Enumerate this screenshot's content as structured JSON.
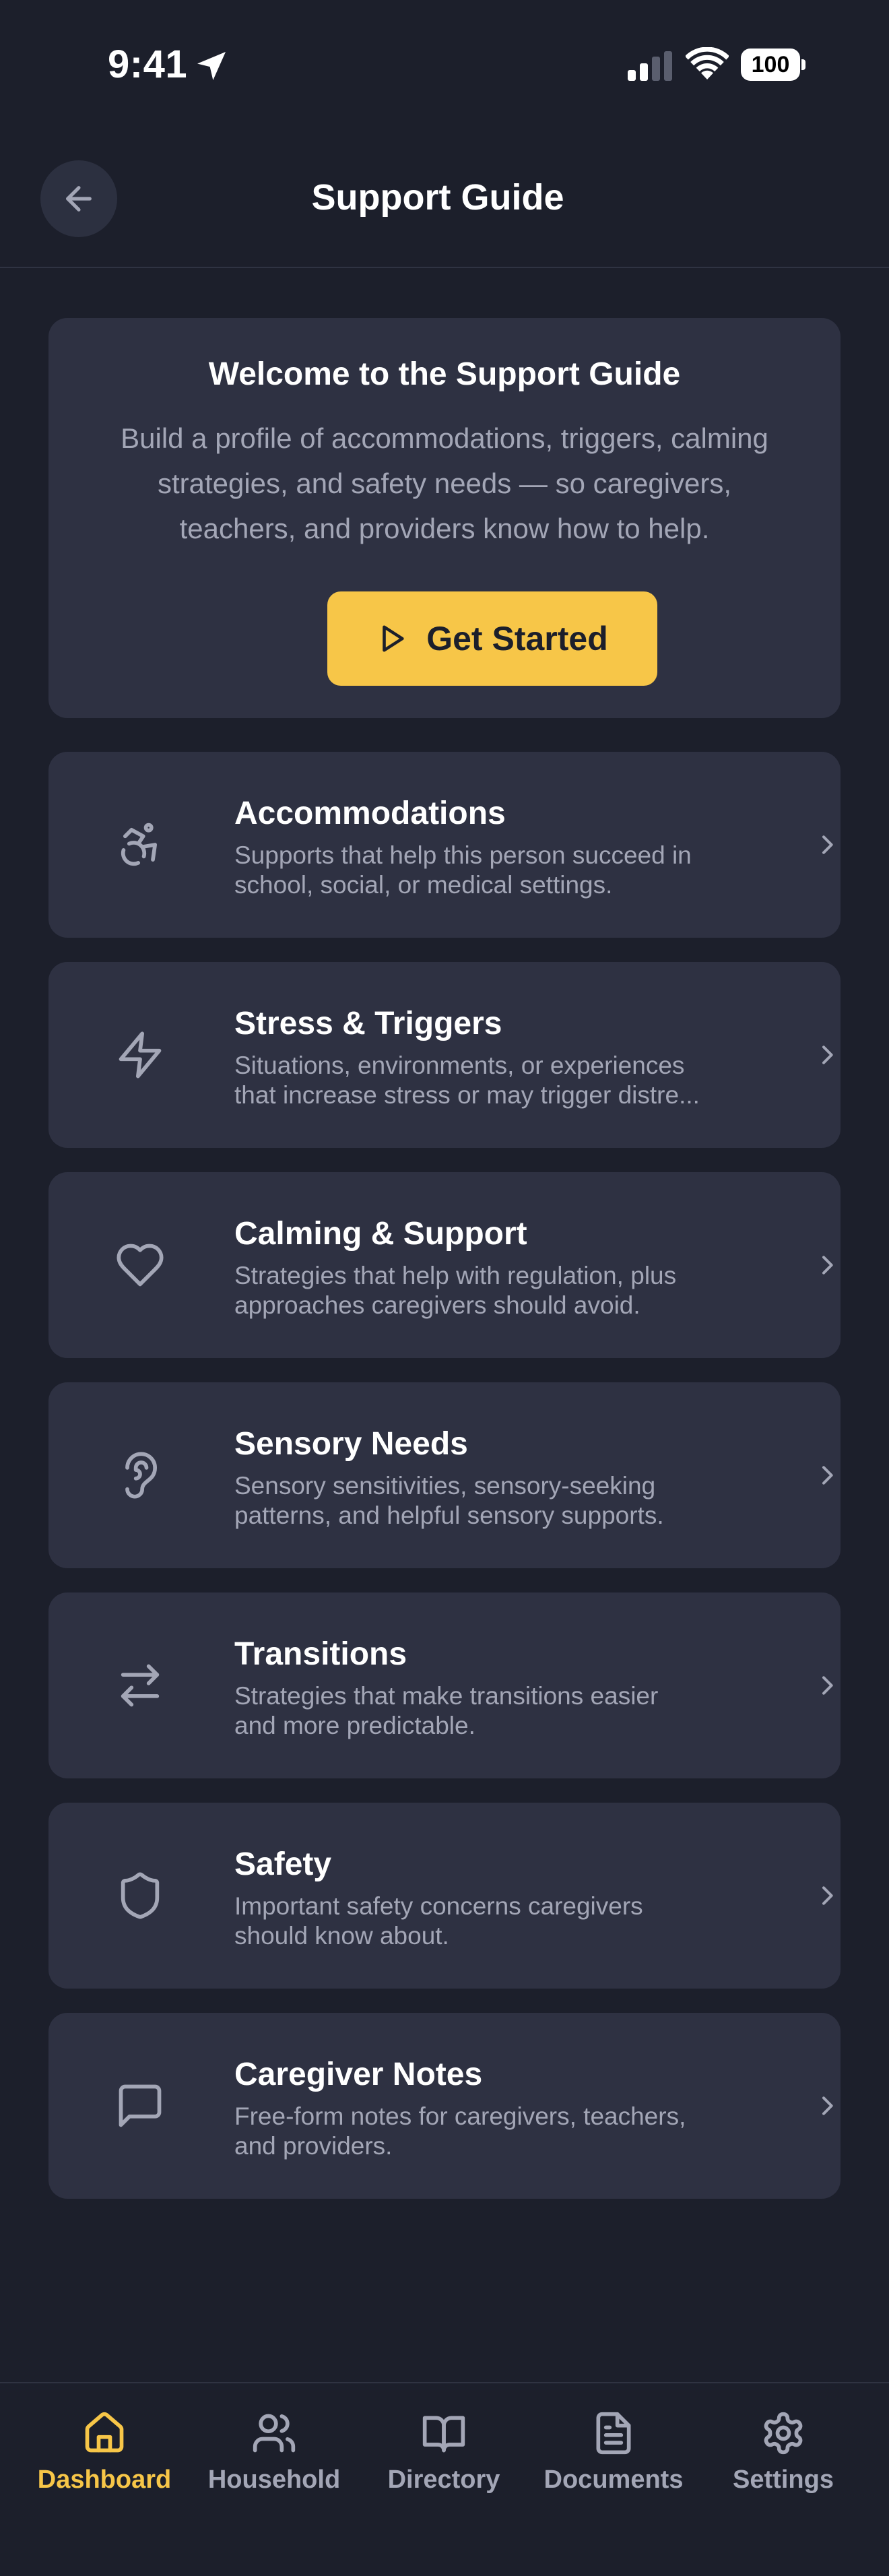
{
  "status_bar": {
    "time": "9:41",
    "battery": "100"
  },
  "header": {
    "title": "Support Guide"
  },
  "welcome": {
    "title": "Welcome to the Support Guide",
    "description_lines": [
      "Build a profile of accommodations, triggers, calming",
      "strategies, and safety needs — so caregivers,",
      "teachers, and providers know how to help."
    ],
    "button_label": "Get Started"
  },
  "sections": [
    {
      "icon": "accessibility-icon",
      "title": "Accommodations",
      "desc_lines": [
        "Supports that help this person succeed in",
        "school, social, or medical settings."
      ]
    },
    {
      "icon": "lightning-icon",
      "title": "Stress & Triggers",
      "desc_lines": [
        "Situations, environments, or experiences",
        "that increase stress or may trigger distre..."
      ]
    },
    {
      "icon": "heart-icon",
      "title": "Calming & Support",
      "desc_lines": [
        "Strategies that help with regulation, plus",
        "approaches caregivers should avoid."
      ]
    },
    {
      "icon": "ear-icon",
      "title": "Sensory Needs",
      "desc_lines": [
        "Sensory sensitivities, sensory-seeking",
        "patterns, and helpful sensory supports."
      ]
    },
    {
      "icon": "arrows-swap-icon",
      "title": "Transitions",
      "desc_lines": [
        "Strategies that make transitions easier",
        "and more predictable."
      ]
    },
    {
      "icon": "shield-icon",
      "title": "Safety",
      "desc_lines": [
        "Important safety concerns caregivers",
        "should know about."
      ]
    },
    {
      "icon": "message-square-icon",
      "title": "Caregiver Notes",
      "desc_lines": [
        "Free-form notes for caregivers, teachers,",
        "and providers."
      ]
    }
  ],
  "tabs": [
    {
      "label": "Dashboard",
      "icon": "home-icon",
      "active": true
    },
    {
      "label": "Household",
      "icon": "users-icon",
      "active": false
    },
    {
      "label": "Directory",
      "icon": "book-open-icon",
      "active": false
    },
    {
      "label": "Documents",
      "icon": "file-text-icon",
      "active": false
    },
    {
      "label": "Settings",
      "icon": "gear-icon",
      "active": false
    }
  ],
  "colors": {
    "background": "#1c1f2b",
    "card": "#2e3142",
    "accent": "#f7c648",
    "muted_text": "#a3a6b6"
  }
}
